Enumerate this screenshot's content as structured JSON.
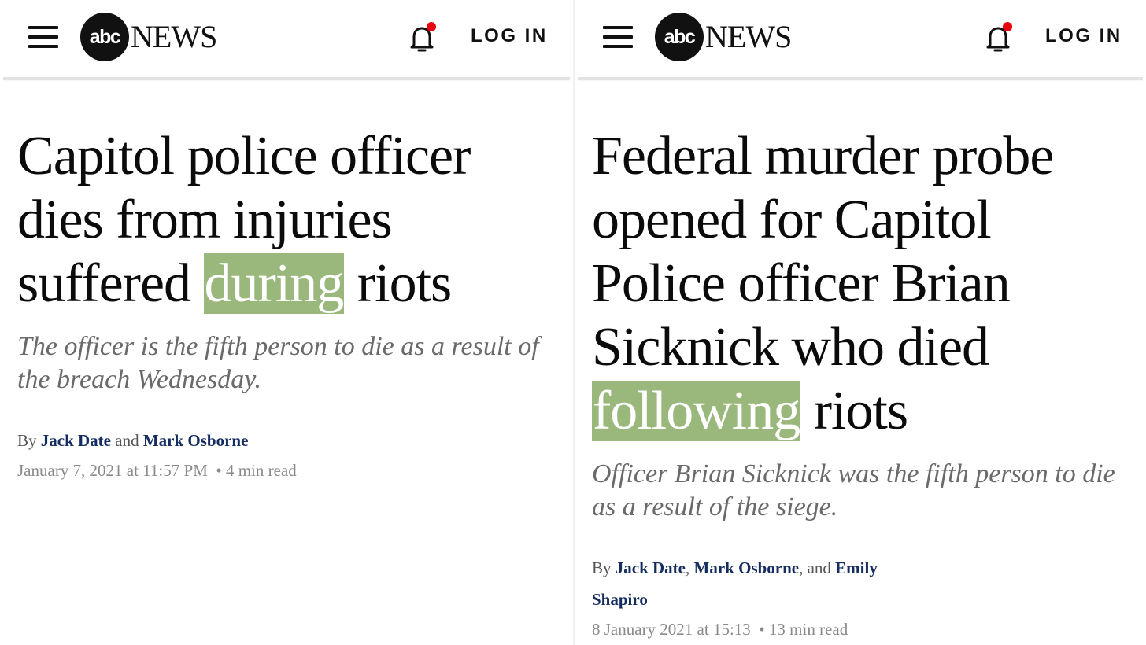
{
  "left": {
    "header": {
      "logo_mark": "abc",
      "logo_text": "NEWS",
      "menu_icon": "hamburger-menu-icon",
      "bell_icon": "notification-bell-icon",
      "login_label": "LOG IN"
    },
    "article": {
      "headline_before": "Capitol police officer dies from injuries suffered ",
      "headline_highlight": "during",
      "headline_after": " riots",
      "subheadline": "The officer is the fifth person to die as a result of the breach Wednesday.",
      "byline_prefix": "By",
      "author_1": "Jack Date",
      "byline_join": "and",
      "author_2": "Mark Osborne",
      "date": "January 7, 2021 at 11:57 PM",
      "read_time": "• 4 min read"
    }
  },
  "right": {
    "header": {
      "logo_mark": "abc",
      "logo_text": "NEWS",
      "menu_icon": "hamburger-menu-icon",
      "bell_icon": "notification-bell-icon",
      "login_label": "LOG IN"
    },
    "article": {
      "headline_before": "Federal murder probe opened for Capitol Police officer Brian Sicknick who died ",
      "headline_highlight": "following",
      "headline_after": " riots",
      "subheadline": "Officer Brian Sicknick was the fifth person to die as a result of the siege.",
      "byline_prefix": "By",
      "author_1": "Jack Date",
      "sep_1": ",",
      "author_2": "Mark Osborne",
      "sep_2": ", and",
      "author_3_line1": "Emily",
      "author_3_line2": "Shapiro",
      "date": "8 January 2021 at 15:13",
      "read_time": "• 13 min read"
    }
  },
  "colors": {
    "highlight": "#9ab87c",
    "author_link": "#142c5f",
    "notification_dot": "#e8000b",
    "subhead": "#6a6a6a",
    "meta": "#8a8a8a"
  }
}
